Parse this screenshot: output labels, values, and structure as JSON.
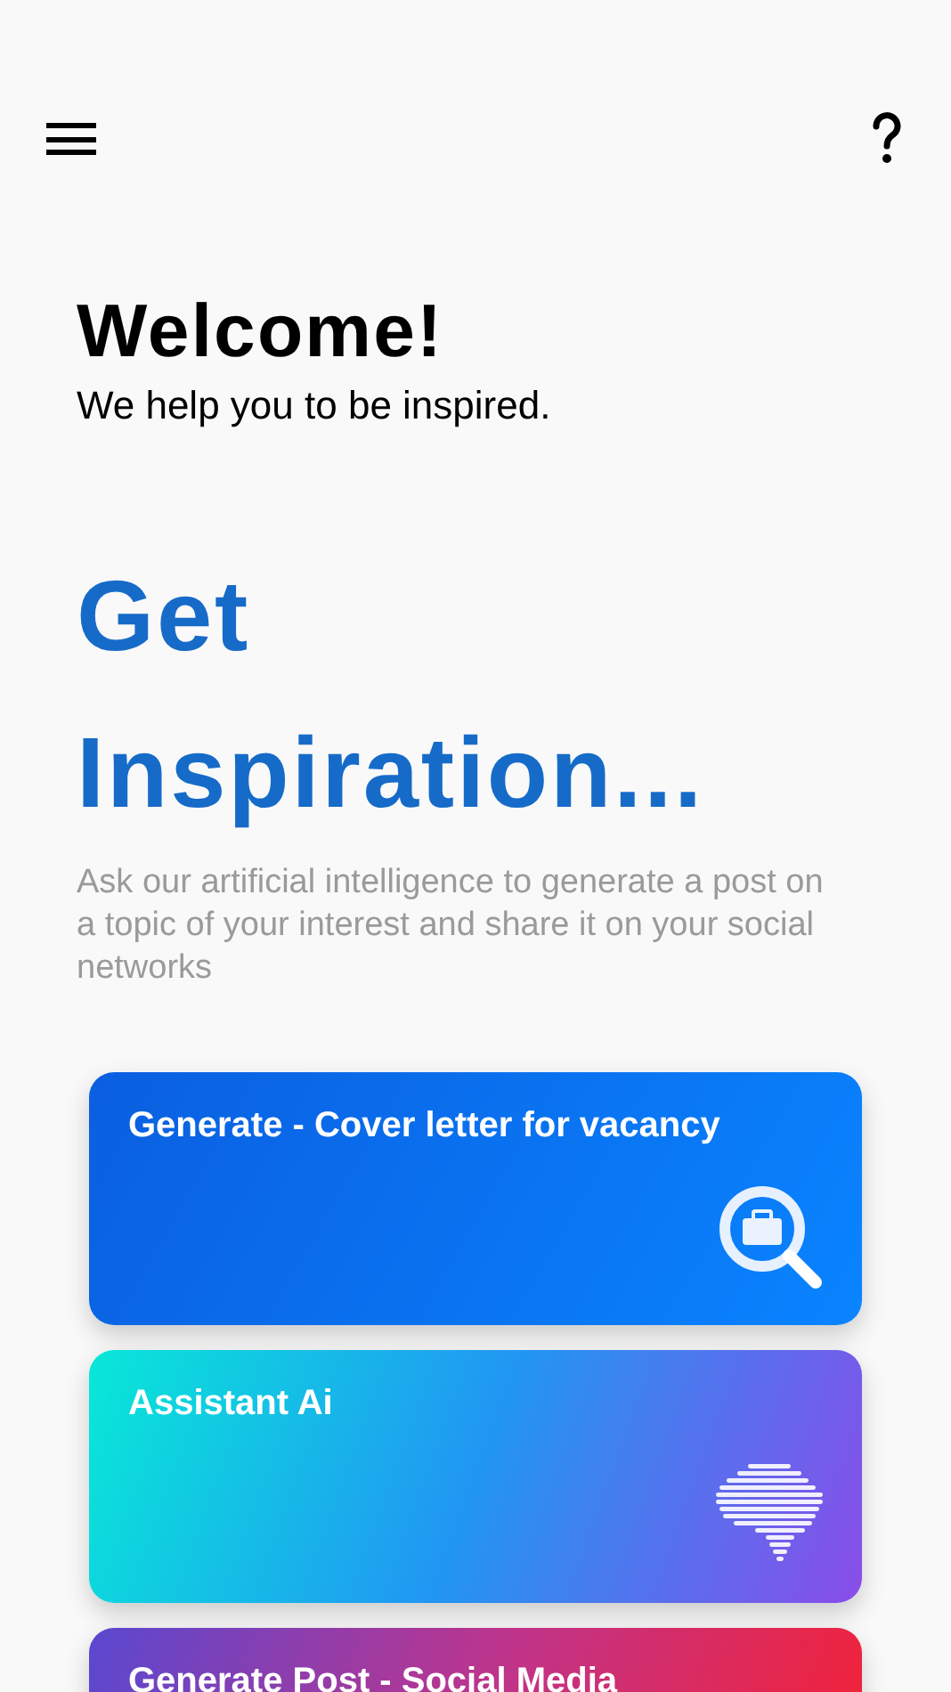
{
  "header": {
    "title": "Welcome!",
    "subtitle": "We help you to be inspired."
  },
  "hero": {
    "title_lines": [
      "Get",
      "Inspiration..."
    ],
    "description": "Ask our artificial intelligence to generate a post on a topic of your interest and share it on your social networks"
  },
  "cards": [
    {
      "title": "Generate - Cover letter for vacancy",
      "kind": "job-search"
    },
    {
      "title": "Assistant Ai",
      "kind": "brain"
    },
    {
      "title": "Generate Post - Social Media",
      "kind": "none"
    }
  ]
}
